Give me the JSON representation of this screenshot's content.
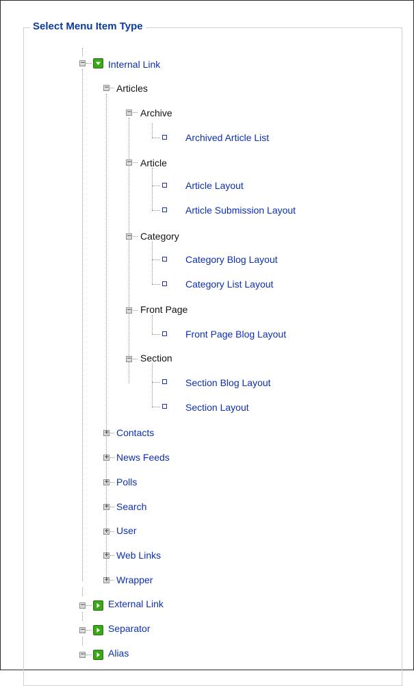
{
  "legend": "Select Menu Item Type",
  "tree": {
    "internal_link": "Internal Link",
    "articles": "Articles",
    "archive": "Archive",
    "archived_article_list": "Archived Article List",
    "article": "Article",
    "article_layout": "Article Layout",
    "article_submission_layout": "Article Submission Layout",
    "category": "Category",
    "category_blog_layout": "Category Blog Layout",
    "category_list_layout": "Category List Layout",
    "front_page": "Front Page",
    "front_page_blog_layout": "Front Page Blog Layout",
    "section": "Section",
    "section_blog_layout": "Section Blog Layout",
    "section_layout": "Section Layout",
    "contacts": "Contacts",
    "news_feeds": "News Feeds",
    "polls": "Polls",
    "search": "Search",
    "user": "User",
    "web_links": "Web Links",
    "wrapper": "Wrapper",
    "external_link": "External Link",
    "separator": "Separator",
    "alias": "Alias"
  },
  "colors": {
    "link": "#0c2fb0",
    "legend": "#0b3b9c",
    "group_icon": "#3aa81a"
  }
}
